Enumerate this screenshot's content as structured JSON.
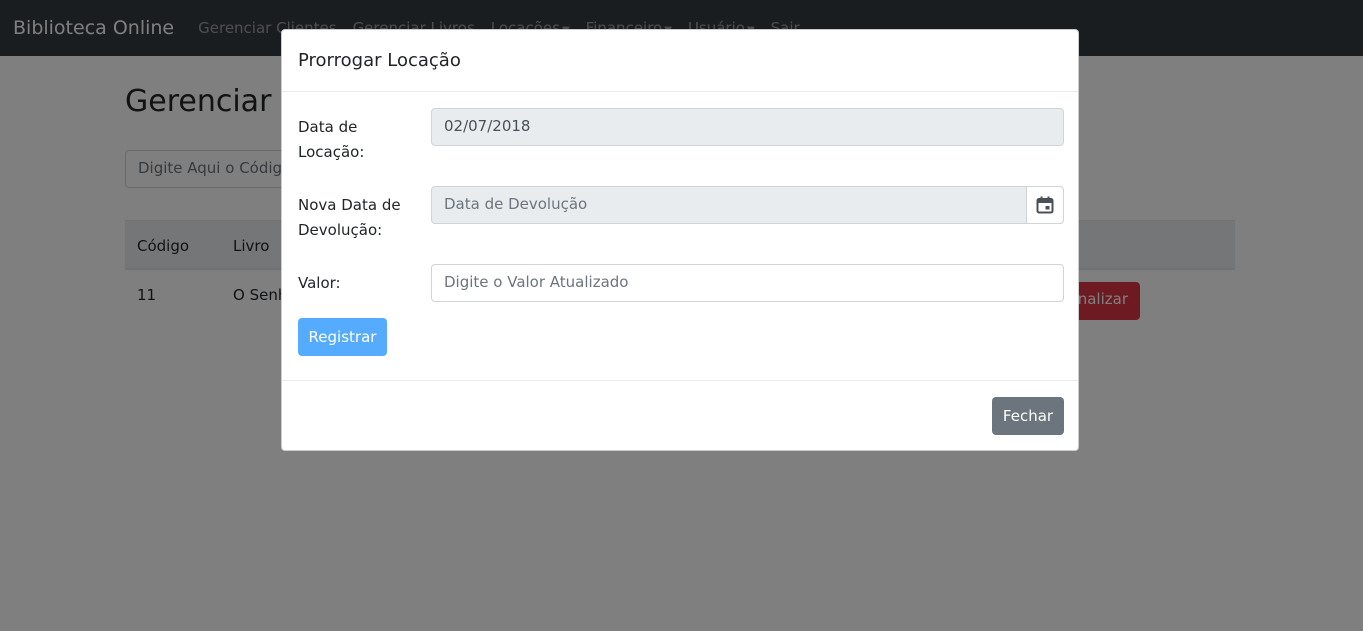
{
  "navbar": {
    "brand": "Biblioteca Online",
    "links": [
      {
        "label": "Gerenciar Clientes"
      },
      {
        "label": "Gerenciar Livros"
      },
      {
        "label": "Locações"
      },
      {
        "label": "Financeiro"
      },
      {
        "label": "Usuário"
      },
      {
        "label": "Sair"
      }
    ],
    "caret": "▼"
  },
  "page": {
    "title": "Gerenciar L",
    "search_placeholder": "Digite Aqui o Códig",
    "table": {
      "headers": [
        "Código",
        "Livro"
      ],
      "rows": [
        {
          "codigo": "11",
          "livro": "O Senh"
        }
      ],
      "finalize_label": "inalizar"
    }
  },
  "modal": {
    "title": "Prorrogar Locação",
    "fields": {
      "data_locacao": {
        "label_line1": "Data de",
        "label_line2": "Locação:",
        "value": "02/07/2018"
      },
      "nova_data": {
        "label_line1": "Nova Data de",
        "label_line2": "Devolução:",
        "placeholder": "Data de Devolução",
        "icon": "calendar-icon"
      },
      "valor": {
        "label": "Valor:",
        "placeholder": "Digite o Valor Atualizado"
      }
    },
    "submit_label": "Registrar",
    "close_label": "Fechar"
  },
  "colors": {
    "navbar_bg": "#343a40",
    "primary_light": "#55acff",
    "secondary": "#6c757d",
    "danger": "#dc3545"
  }
}
